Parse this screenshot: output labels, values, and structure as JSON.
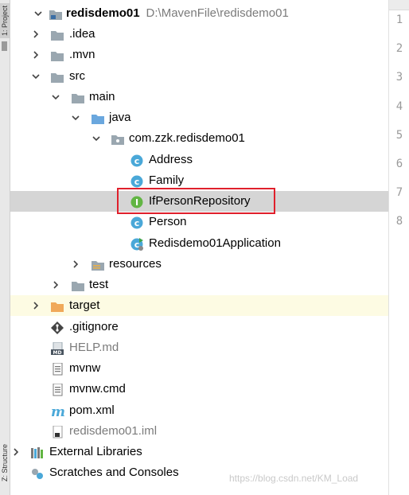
{
  "side_tabs": {
    "top": "1: Project",
    "bottom": "Z: Structure"
  },
  "project": {
    "name": "redisdemo01",
    "path": "D:\\MavenFile\\redisdemo01"
  },
  "tree": {
    "idea": ".idea",
    "mvn": ".mvn",
    "src": "src",
    "main": "main",
    "java": "java",
    "package": "com.zzk.redisdemo01",
    "address": "Address",
    "family": "Family",
    "repo": "IfPersonRepository",
    "person": "Person",
    "app": "Redisdemo01Application",
    "resources": "resources",
    "test": "test",
    "target": "target",
    "gitignore": ".gitignore",
    "help": "HELP.md",
    "mvnw": "mvnw",
    "mvnw_cmd": "mvnw.cmd",
    "pom": "pom.xml",
    "iml": "redisdemo01.iml",
    "external": "External Libraries",
    "scratches": "Scratches and Consoles"
  },
  "line_numbers": [
    "1",
    "2",
    "3",
    "4",
    "5",
    "6",
    "7",
    "8"
  ],
  "watermark": "https://blog.csdn.net/KM_Load",
  "colors": {
    "folder": "#9aa7b0",
    "source_folder": "#6aa7de",
    "excluded_folder": "#f0a95a",
    "class_icon": "#4aa8d8",
    "interface_icon": "#62b543",
    "selection_box": "#e0202c"
  }
}
